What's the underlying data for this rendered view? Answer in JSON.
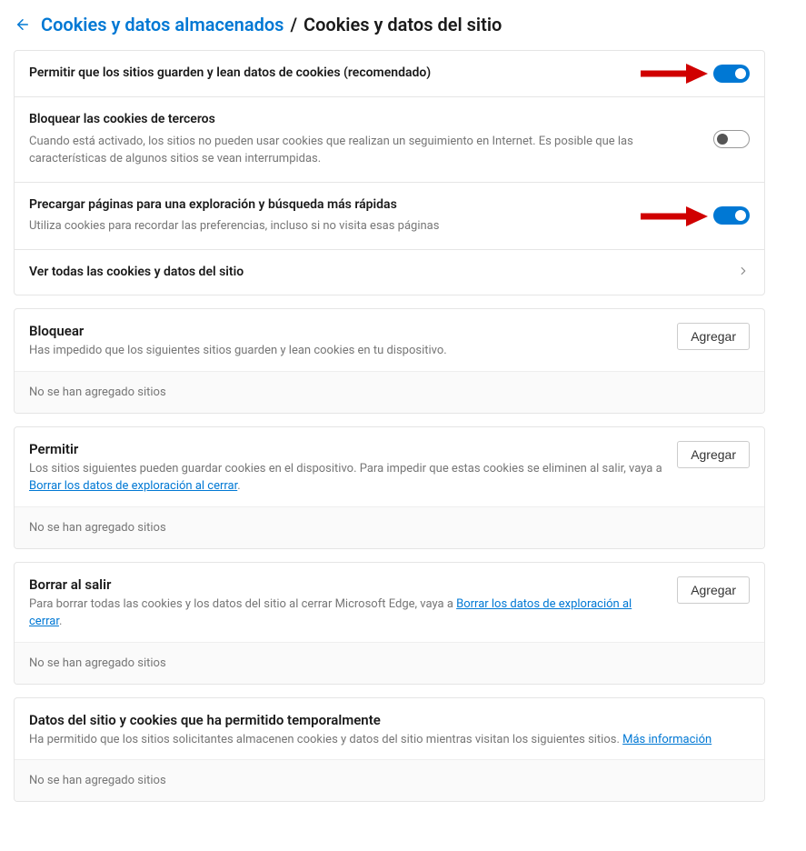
{
  "breadcrumb": {
    "parent": "Cookies y datos almacenados",
    "separator": "/",
    "current": "Cookies y datos del sitio"
  },
  "settings": {
    "allow_cookies": {
      "title": "Permitir que los sitios guarden y lean datos de cookies (recomendado)",
      "enabled": true
    },
    "block_third_party": {
      "title": "Bloquear las cookies de terceros",
      "desc": "Cuando está activado, los sitios no pueden usar cookies que realizan un seguimiento en Internet. Es posible que las características de algunos sitios se vean interrumpidas.",
      "enabled": false
    },
    "preload": {
      "title": "Precargar páginas para una exploración y búsqueda más rápidas",
      "desc": "Utiliza cookies para recordar las preferencias, incluso si no visita esas páginas",
      "enabled": true
    },
    "see_all": {
      "title": "Ver todas las cookies y datos del sitio"
    }
  },
  "sections": {
    "block": {
      "title": "Bloquear",
      "desc": "Has impedido que los siguientes sitios guarden y lean cookies en tu dispositivo.",
      "add_button": "Agregar",
      "empty": "No se han agregado sitios"
    },
    "allow": {
      "title": "Permitir",
      "desc_prefix": "Los sitios siguientes pueden guardar cookies en el dispositivo. Para impedir que estas cookies se eliminen al salir, vaya a ",
      "link": "Borrar los datos de exploración al cerrar",
      "desc_suffix": ".",
      "add_button": "Agregar",
      "empty": "No se han agregado sitios"
    },
    "delete_on_exit": {
      "title": "Borrar al salir",
      "desc_prefix": "Para borrar todas las cookies y los datos del sitio al cerrar Microsoft Edge, vaya a ",
      "link": "Borrar los datos de exploración al cerrar",
      "desc_suffix": ".",
      "add_button": "Agregar",
      "empty": "No se han agregado sitios"
    },
    "temporary": {
      "title": "Datos del sitio y cookies que ha permitido temporalmente",
      "desc_prefix": "Ha permitido que los sitios solicitantes almacenen cookies y datos del sitio mientras visitan los siguientes sitios. ",
      "link": "Más información",
      "empty": "No se han agregado sitios"
    }
  }
}
